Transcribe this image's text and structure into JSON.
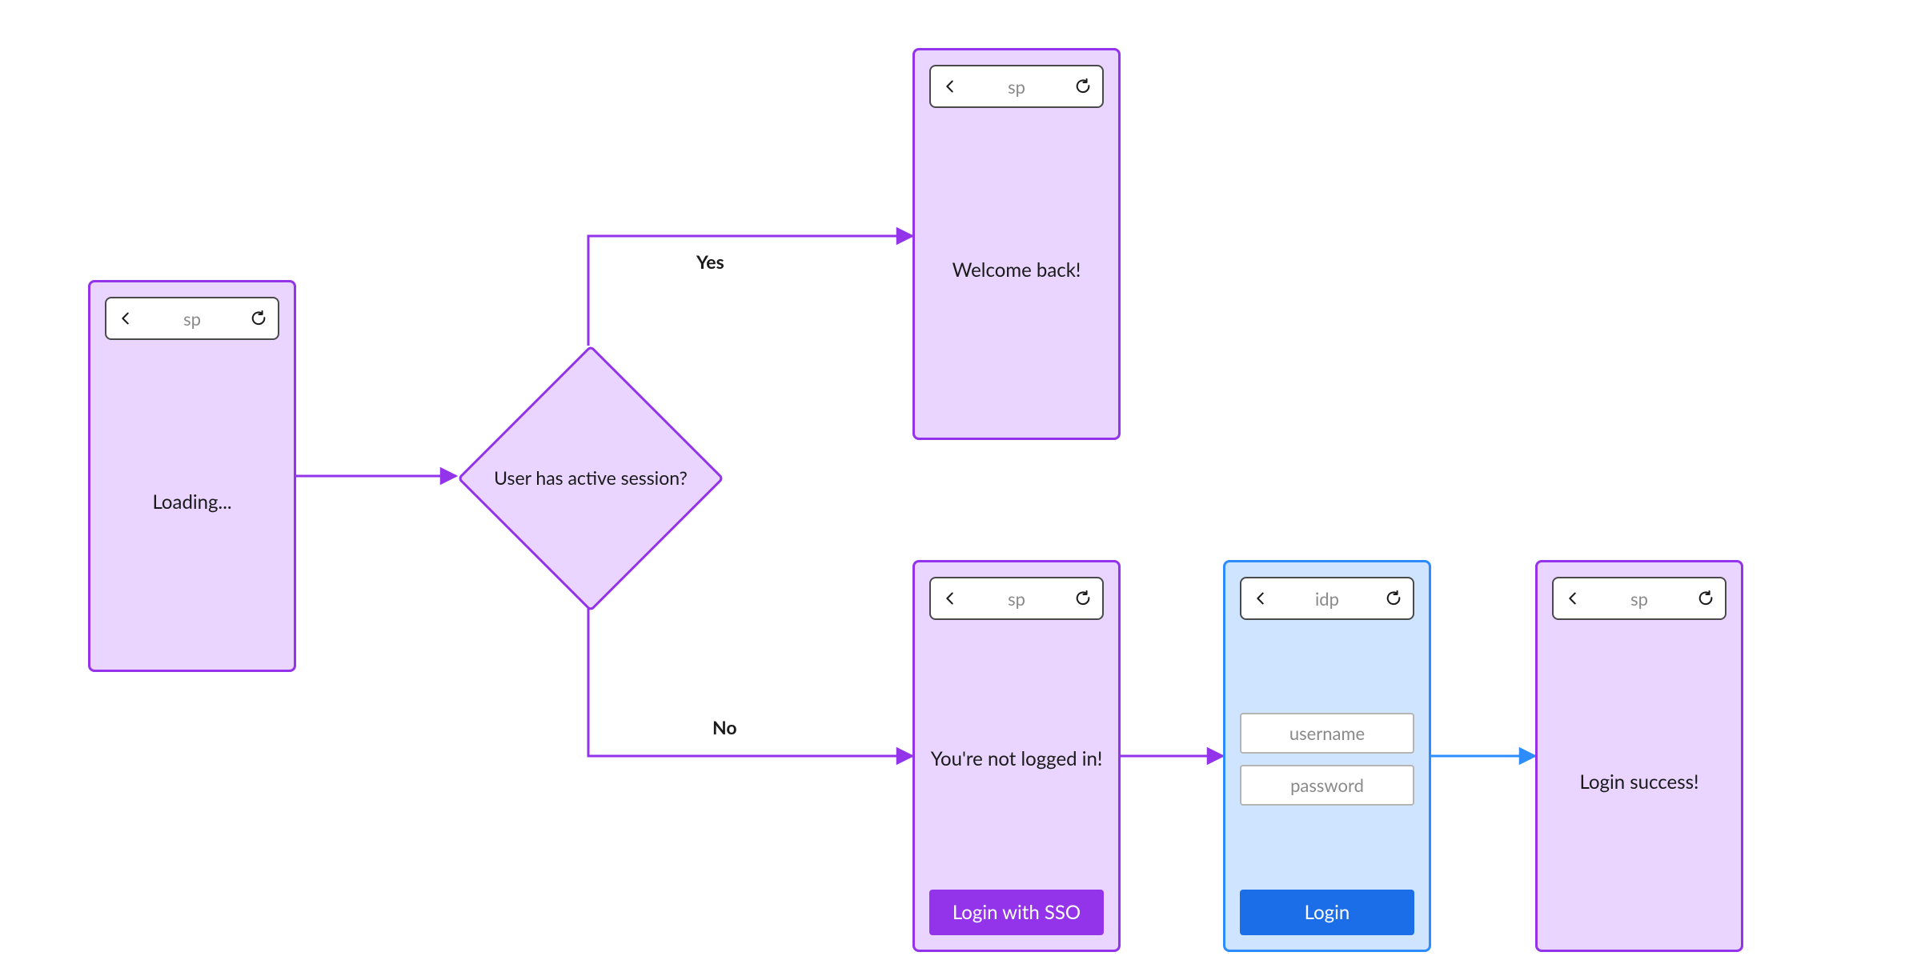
{
  "decision": {
    "label": "User has active session?"
  },
  "branches": {
    "yes": "Yes",
    "no": "No"
  },
  "screens": {
    "loading": {
      "host": "sp",
      "message": "Loading..."
    },
    "welcome": {
      "host": "sp",
      "message": "Welcome back!"
    },
    "notlogged": {
      "host": "sp",
      "message": "You're not logged in!",
      "button": "Login with SSO"
    },
    "idp": {
      "host": "idp",
      "username_ph": "username",
      "password_ph": "password",
      "button": "Login"
    },
    "success": {
      "host": "sp",
      "message": "Login success!"
    }
  },
  "colors": {
    "purple_border": "#9333ea",
    "purple_fill": "#e9d5ff",
    "blue_border": "#2d8cff",
    "blue_fill": "#cfe4ff",
    "arrow_purple": "#9333ea",
    "arrow_blue": "#2d8cff"
  }
}
